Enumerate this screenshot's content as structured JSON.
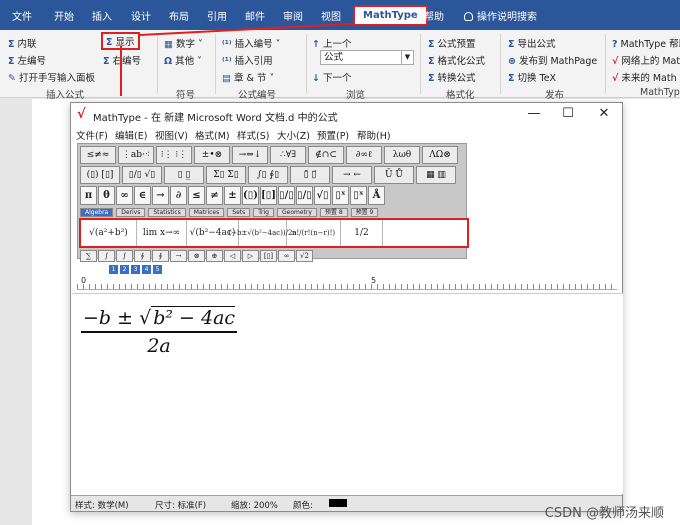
{
  "word_tabs": [
    "文件",
    "开始",
    "插入",
    "设计",
    "布局",
    "引用",
    "邮件",
    "审阅",
    "视图",
    "MathType",
    "帮助",
    "操作说明搜索"
  ],
  "ribbon": {
    "insert_group": {
      "items": [
        "内联",
        "左编号",
        "打开手写输入面板",
        "显示",
        "右编号"
      ],
      "label": "插入公式"
    },
    "symbols_group": {
      "items": [
        "数字",
        "其他"
      ],
      "label": "符号"
    },
    "numbering_group": {
      "items": [
        "插入编号",
        "插入引用",
        "章 & 节"
      ],
      "label": "公式编号"
    },
    "browse_group": {
      "items": [
        "上一个",
        "公式",
        "下一个"
      ],
      "label": "浏览"
    },
    "format_group": {
      "items": [
        "公式预置",
        "格式化公式",
        "转换公式"
      ],
      "label": "格式化"
    },
    "publish_group": {
      "items": [
        "导出公式",
        "发布到 MathPage",
        "切换 TeX"
      ],
      "label": "发布"
    },
    "mathtype_group": {
      "items": [
        "MathType 帮助",
        "网络上的 Math",
        "未来的 Math"
      ],
      "label": "MathType"
    }
  },
  "mathtype_window": {
    "title": "MathType - 在 新建 Microsoft Word 文档.d 中的公式",
    "menu": [
      "文件(F)",
      "编辑(E)",
      "视图(V)",
      "格式(M)",
      "样式(S)",
      "大小(Z)",
      "预置(P)",
      "帮助(H)"
    ],
    "toolbar_row1": [
      "≤≠≈",
      "⋮ab·⁖",
      "⁝⋮ ⁝⋮",
      "±•⊗",
      "→⇔↓",
      "∴∀∃",
      "∉∩⊂",
      "∂∞ℓ",
      "λωθ",
      "ΛΩ⊗"
    ],
    "toolbar_row2": [
      "(▯) [▯]",
      "▯/▯ √▯",
      "▯ ▯̲",
      "Σ▯ Σ▯",
      "∫▯ ∮▯",
      "▯̄ ▯⃗",
      "→ ←",
      "Ū Ů",
      "▦ ▥"
    ],
    "toolbar_row3": [
      "π",
      "θ",
      "∞",
      "∈",
      "→",
      "∂",
      "≤",
      "≠",
      "±",
      "(▯)",
      "[▯]",
      "▯/▯",
      "▯/▯",
      "√▯",
      "▯ˣ",
      "▯ˣ",
      "Å"
    ],
    "tabs": [
      "Algebra",
      "Derivs",
      "Statistics",
      "Matrices",
      "Sets",
      "Trig",
      "Geometry",
      "预置 8",
      "预置 9"
    ],
    "templates": [
      "√(a²+b²)",
      "lim x→∞",
      "√(b²−4ac)",
      "(−b±√(b²−4ac))/2a",
      "n!/(r!(n−r)!)",
      "1/2"
    ],
    "toolbar_row5": [
      "∑",
      "∫",
      "∫",
      "∮",
      "∮",
      "→",
      "⊗",
      "⊕",
      "◁",
      "▷",
      "[▯]",
      "∞",
      "√2"
    ],
    "size_buttons": [
      "1",
      "2",
      "3",
      "4",
      "5"
    ],
    "ruler": {
      "zero": "0",
      "mark": "5"
    },
    "formula": {
      "numerator_prefix": "−b ± ",
      "radicand": "b² − 4ac",
      "denominator": "2a"
    },
    "status": {
      "style": "样式: 数学(M)",
      "size": "尺寸: 标准(F)",
      "zoom": "缩放: 200%",
      "color": "颜色:"
    }
  },
  "watermark": "CSDN @教师汤来顺",
  "colors": {
    "word_blue": "#2b579a",
    "highlight_red": "#e02020"
  }
}
